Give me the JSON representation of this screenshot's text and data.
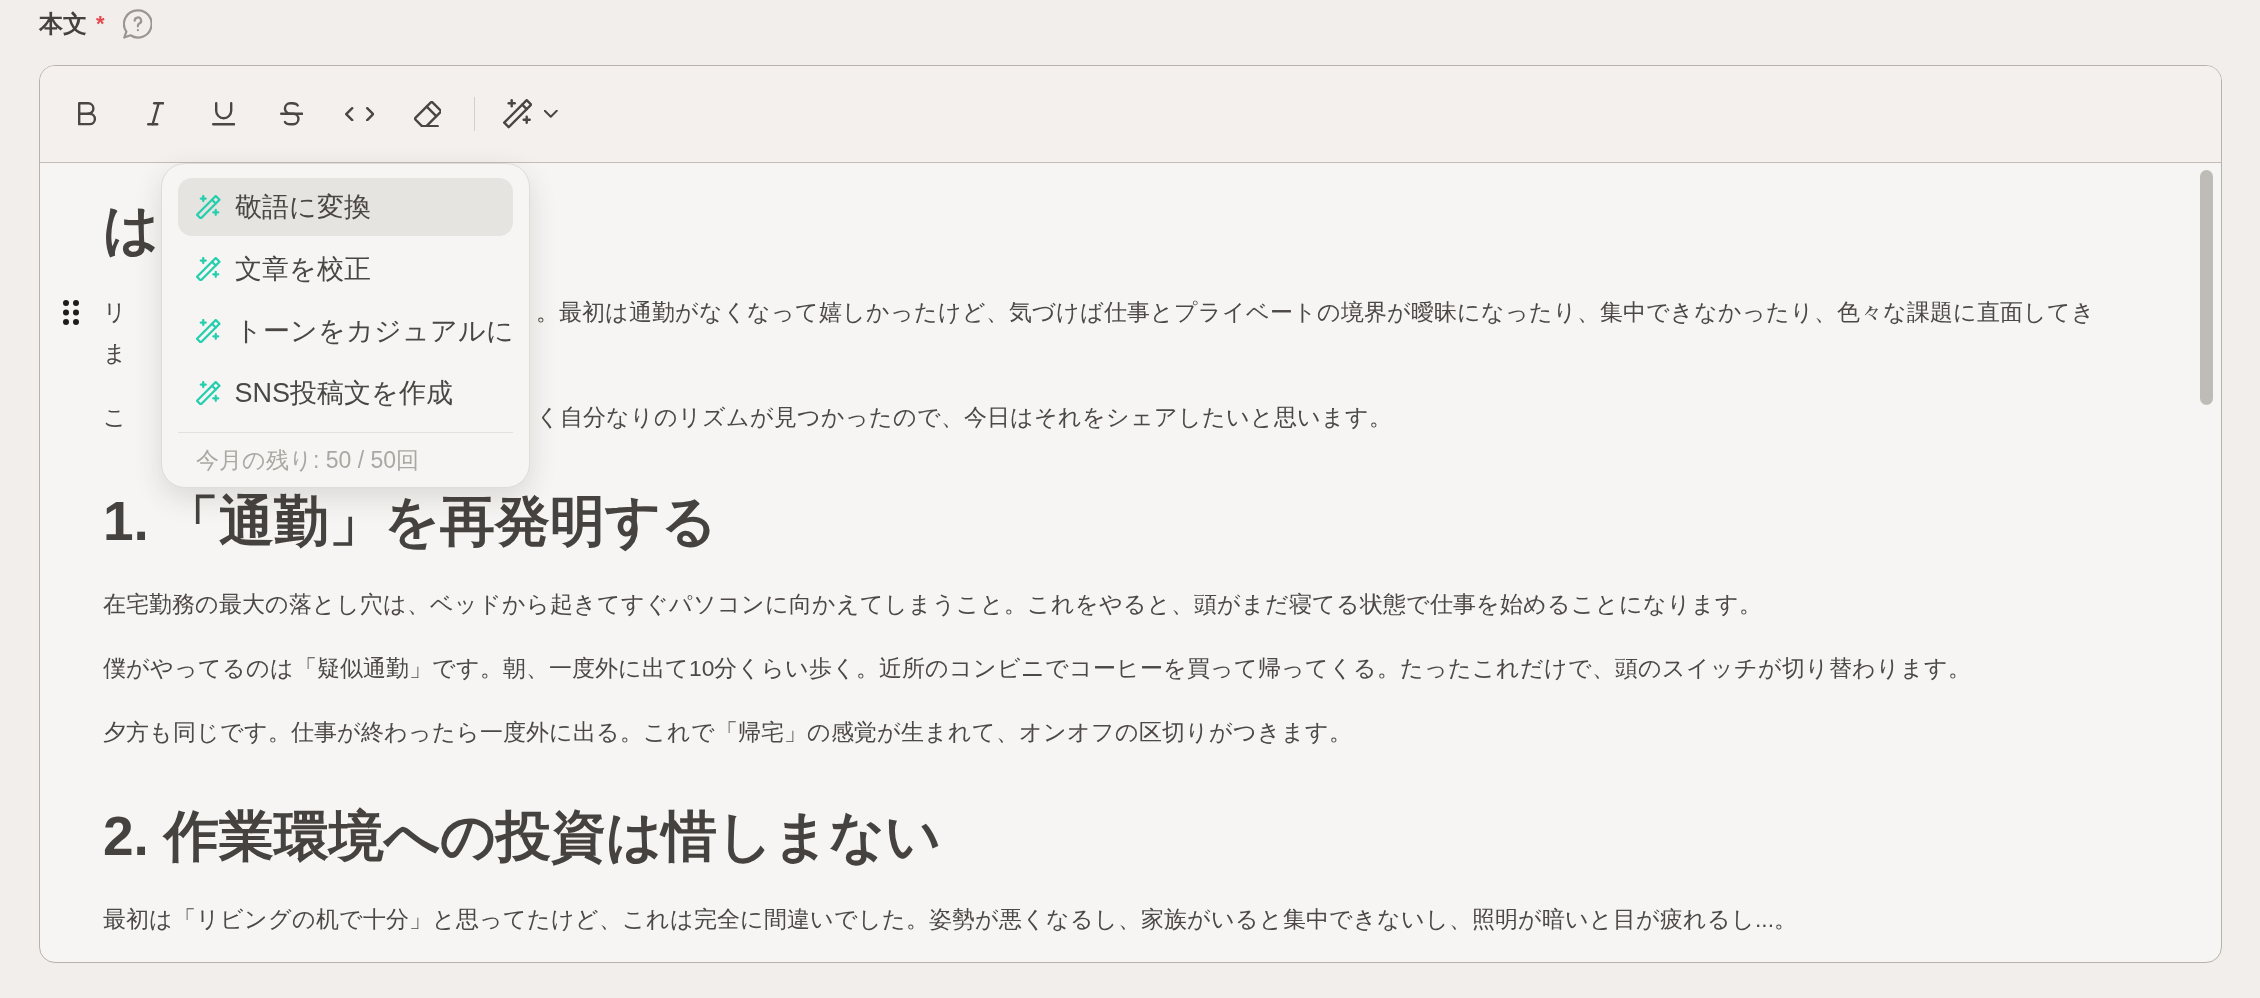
{
  "field": {
    "label": "本文",
    "required_mark": "*"
  },
  "editor": {
    "blocks": [
      {
        "kind": "heading",
        "hovered": false,
        "text": "は"
      },
      {
        "kind": "partial_paragraph",
        "hovered": true,
        "lines": [
          [
            "リ",
            "。最初は通勤がなくなって嬉しかったけど、気づけば仕事とプライベートの境界が曖昧になったり、集中できなかったり、色々な課題に直面してき"
          ],
          [
            "ま"
          ]
        ]
      },
      {
        "kind": "partial_paragraph",
        "hovered": false,
        "lines": [
          [
            "こ",
            "く自分なりのリズムが見つかったので、今日はそれをシェアしたいと思います。"
          ]
        ]
      },
      {
        "kind": "heading",
        "hovered": false,
        "text": "1. 「通勤」を再発明する"
      },
      {
        "kind": "paragraph",
        "hovered": false,
        "text": "在宅勤務の最大の落とし穴は、ベッドから起きてすぐパソコンに向かえてしまうこと。これをやると、頭がまだ寝てる状態で仕事を始めることになります。"
      },
      {
        "kind": "paragraph",
        "hovered": false,
        "text": "僕がやってるのは「疑似通勤」です。朝、一度外に出て10分くらい歩く。近所のコンビニでコーヒーを買って帰ってくる。たったこれだけで、頭のスイッチが切り替わります。"
      },
      {
        "kind": "paragraph",
        "hovered": false,
        "text": "夕方も同じです。仕事が終わったら一度外に出る。これで「帰宅」の感覚が生まれて、オンオフの区切りがつきます。"
      },
      {
        "kind": "heading",
        "hovered": false,
        "text": "2. 作業環境への投資は惜しまない"
      },
      {
        "kind": "paragraph",
        "hovered": false,
        "text": "最初は「リビングの机で十分」と思ってたけど、これは完全に間違いでした。姿勢が悪くなるし、家族がいると集中できないし、照明が暗いと目が疲れるし...。"
      }
    ]
  },
  "ai_menu": {
    "items": [
      {
        "label": "敬語に変換",
        "selected": true
      },
      {
        "label": "文章を校正",
        "selected": false
      },
      {
        "label": "トーンをカジュアルに",
        "selected": false
      },
      {
        "label": "SNS投稿文を作成",
        "selected": false
      }
    ],
    "quota": "今月の残り: 50 / 50回"
  }
}
